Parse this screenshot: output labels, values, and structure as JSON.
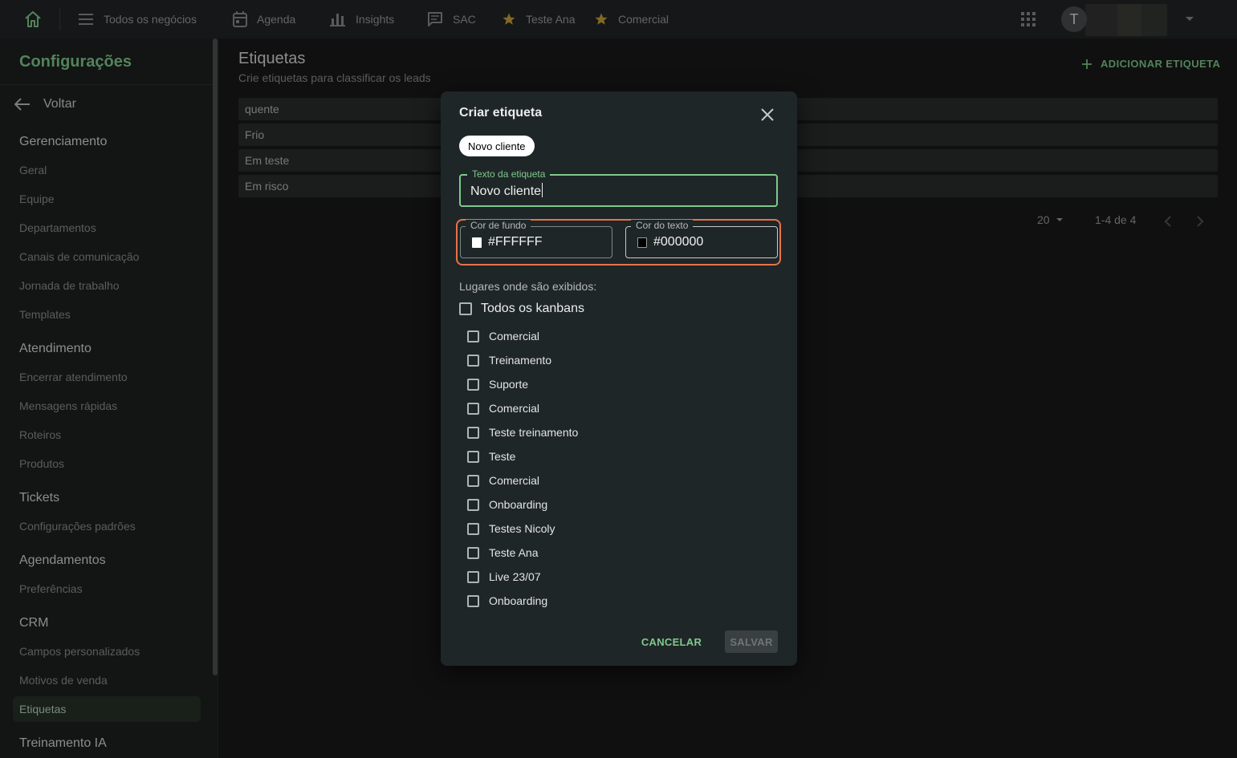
{
  "topbar": {
    "nav": [
      {
        "label": "Todos os negócios",
        "icon": "menu-icon"
      },
      {
        "label": "Agenda",
        "icon": "calendar-icon"
      },
      {
        "label": "Insights",
        "icon": "bar-chart-icon"
      },
      {
        "label": "SAC",
        "icon": "chat-icon"
      },
      {
        "label": "Teste Ana",
        "icon": "star-icon"
      },
      {
        "label": "Comercial",
        "icon": "star-icon"
      }
    ],
    "avatar_initial": "T"
  },
  "sidebar": {
    "title": "Configurações",
    "back_label": "Voltar",
    "sections": [
      {
        "title": "Gerenciamento",
        "items": [
          "Geral",
          "Equipe",
          "Departamentos",
          "Canais de comunicação",
          "Jornada de trabalho",
          "Templates"
        ]
      },
      {
        "title": "Atendimento",
        "items": [
          "Encerrar atendimento",
          "Mensagens rápidas",
          "Roteiros",
          "Produtos"
        ]
      },
      {
        "title": "Tickets",
        "items": [
          "Configurações padrões"
        ]
      },
      {
        "title": "Agendamentos",
        "items": [
          "Preferências"
        ]
      },
      {
        "title": "CRM",
        "items": [
          "Campos personalizados",
          "Motivos de venda",
          "Etiquetas"
        ]
      },
      {
        "title": "Treinamento IA",
        "items": []
      }
    ],
    "active_item": "Etiquetas"
  },
  "main": {
    "title": "Etiquetas",
    "subtitle": "Crie etiquetas para classificar os leads",
    "add_button": "ADICIONAR ETIQUETA",
    "tags": [
      "quente",
      "Frio",
      "Em teste",
      "Em risco"
    ],
    "pagination": {
      "per_page": "20",
      "range": "1-4 de 4"
    }
  },
  "dialog": {
    "title": "Criar etiqueta",
    "preview_text": "Novo cliente",
    "text_field": {
      "label": "Texto da etiqueta",
      "value": "Novo cliente"
    },
    "background_color": {
      "label": "Cor de fundo",
      "value": "#FFFFFF"
    },
    "text_color": {
      "label": "Cor do texto",
      "value": "#000000"
    },
    "places_label": "Lugares onde são exibidos:",
    "all_kanbans_label": "Todos os kanbans",
    "kanbans": [
      "Comercial",
      "Treinamento",
      "Suporte",
      "Comercial",
      "Teste treinamento",
      "Teste",
      "Comercial",
      "Onboarding",
      "Testes Nicoly",
      "Teste Ana",
      "Live 23/07",
      "Onboarding"
    ],
    "cancel_label": "CANCELAR",
    "save_label": "SALVAR"
  },
  "colors": {
    "accent": "#7fc98b",
    "highlight": "#e4734a",
    "star": "#c9a23a"
  }
}
